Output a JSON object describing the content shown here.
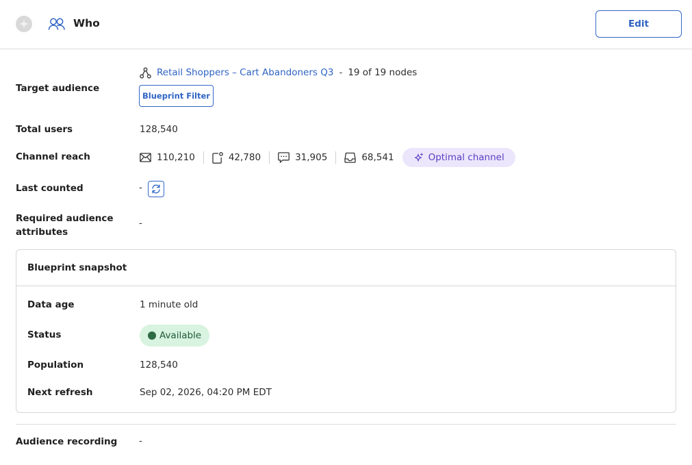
{
  "header": {
    "title": "Who",
    "edit_label": "Edit",
    "collapse_icon": "plus-icon",
    "title_icon": "people-icon"
  },
  "target_audience": {
    "label": "Target audience",
    "audience_name": "Retail Shoppers – Cart Abandoners Q3",
    "separator": "-",
    "nodes": "19 of 19 nodes",
    "filter_badge": "Blueprint Filter"
  },
  "total_users": {
    "label": "Total users",
    "value": "128,540"
  },
  "channel_reach": {
    "label": "Channel reach",
    "email": "110,210",
    "push": "42,780",
    "sms": "31,905",
    "inbox": "68,541",
    "optimal_label": "Optimal channel"
  },
  "last_counted": {
    "label": "Last counted",
    "value": "-"
  },
  "required_attributes": {
    "label_line1": "Required audience",
    "label_line2": "attributes",
    "value": "-"
  },
  "snapshot": {
    "title": "Blueprint snapshot",
    "data_age_label": "Data age",
    "data_age_value": "1 minute old",
    "status_label": "Status",
    "status_value": "Available",
    "population_label": "Population",
    "population_value": "128,540",
    "next_refresh_label": "Next refresh",
    "next_refresh_value": "Sep 02, 2026, 04:20 PM EDT"
  },
  "audience_recording": {
    "label": "Audience recording",
    "value": "-"
  },
  "colors": {
    "accent": "#2f63c4",
    "optimal_bg": "#ebe6fb",
    "optimal_text": "#5b3fc4",
    "available_bg": "#d8f3e0",
    "available_dot": "#2d6a45"
  }
}
